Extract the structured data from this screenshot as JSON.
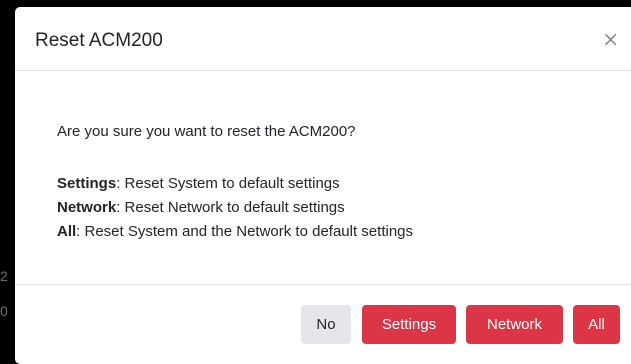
{
  "backdrop": {
    "marks": [
      "2",
      "0"
    ]
  },
  "dialog": {
    "title": "Reset ACM200",
    "close_glyph": "×",
    "question": "Are you sure you want to reset the ACM200?",
    "options": [
      {
        "name": "Settings",
        "description": ": Reset System to default settings"
      },
      {
        "name": "Network",
        "description": ": Reset Network to default settings"
      },
      {
        "name": "All",
        "description": ": Reset System and the Network to default settings"
      }
    ],
    "buttons": {
      "no": "No",
      "settings": "Settings",
      "network": "Network",
      "all": "All"
    }
  },
  "colors": {
    "danger": "#dc3545",
    "secondary": "#e4e6e9",
    "backdrop": "#000000"
  },
  "icons": {
    "close": "close-icon"
  }
}
